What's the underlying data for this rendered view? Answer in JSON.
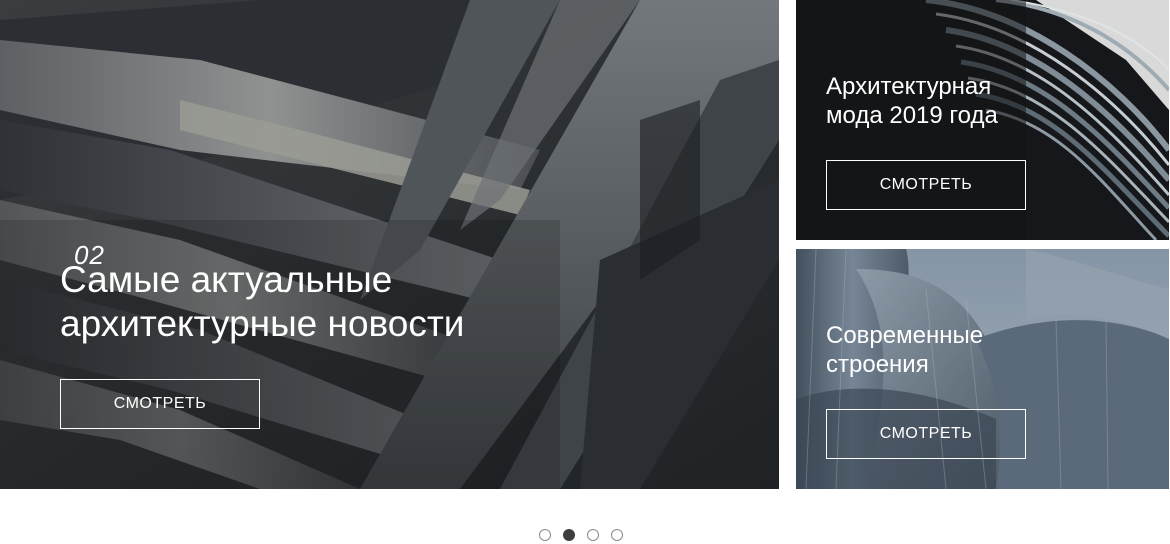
{
  "main_slide": {
    "number": "02",
    "title_line1": "Самые актуальные",
    "title_line2": "архитектурные новости",
    "button_label": "СМОТРЕТЬ"
  },
  "cards": [
    {
      "title_line1": "Архитектурная",
      "title_line2": "мода 2019 года",
      "button_label": "СМОТРЕТЬ"
    },
    {
      "title_line1": "Современные",
      "title_line2": "строения",
      "button_label": "СМОТРЕТЬ"
    }
  ],
  "pagination": {
    "count": 4,
    "active_index": 1
  },
  "colors": {
    "text": "#ffffff",
    "dot_active": "#3e3e3e",
    "dot_border": "#8c8c8c"
  }
}
